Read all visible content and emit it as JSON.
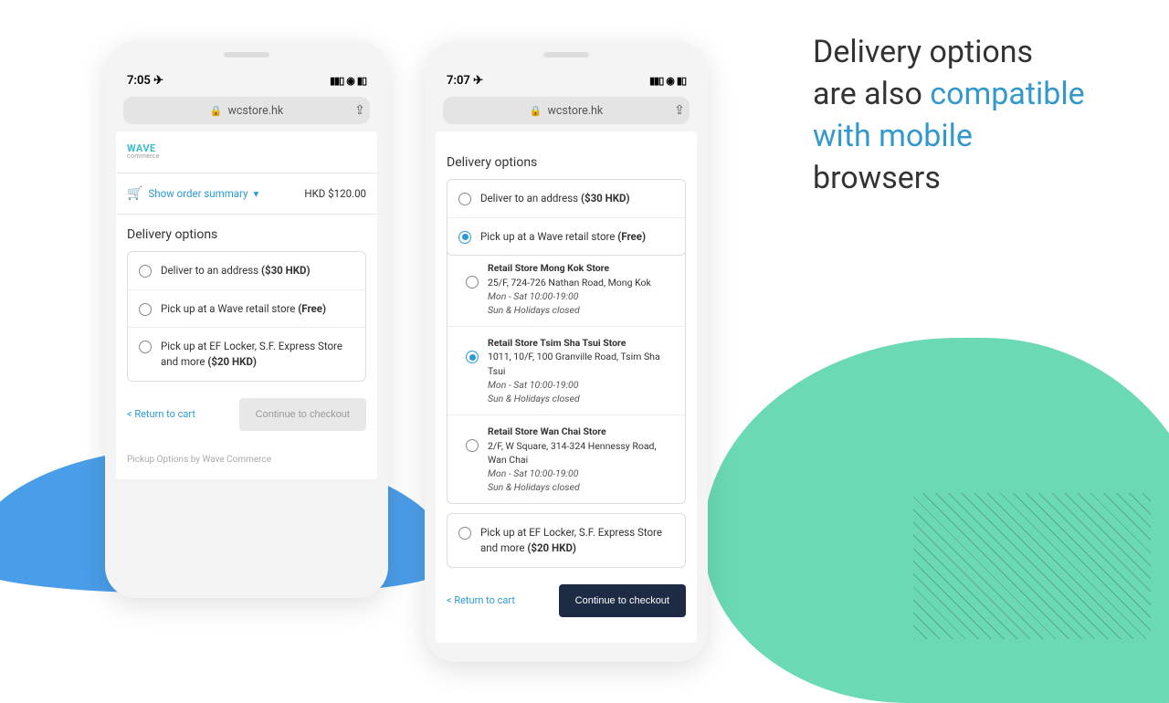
{
  "headline": {
    "line1": "Delivery options",
    "line2_plain": "are also ",
    "line2_accent": "compatible",
    "line3_accent": "with mobile",
    "line4_plain": "browsers"
  },
  "phoneLeft": {
    "time": "7:05",
    "url": "wcstore.hk",
    "brand_top": "WAVE",
    "brand_bottom": "commerce",
    "summary_toggle": "Show order summary",
    "summary_price": "HKD $120.00",
    "section_title": "Delivery options",
    "options": [
      {
        "label": "Deliver to an address ",
        "price": "($30 HKD)"
      },
      {
        "label": "Pick up at a Wave retail store ",
        "price": "(Free)"
      },
      {
        "label": "Pick up at EF Locker, S.F. Express Store and more ",
        "price": "($20 HKD)"
      }
    ],
    "return_link": "< Return to cart",
    "checkout_label": "Continue to checkout",
    "powered": "Pickup Options by Wave Commerce"
  },
  "phoneRight": {
    "time": "7:07",
    "url": "wcstore.hk",
    "section_title": "Delivery options",
    "option_deliver": {
      "label": "Deliver to an address ",
      "price": "($30 HKD)"
    },
    "option_pickup": {
      "label": "Pick up at a Wave retail store ",
      "price": "(Free)"
    },
    "stores": [
      {
        "name": "Retail Store Mong Kok Store",
        "address": "25/F, 724-726 Nathan Road, Mong Kok",
        "hours1": "Mon - Sat 10:00-19:00",
        "hours2": "Sun & Holidays closed"
      },
      {
        "name": "Retail Store Tsim Sha Tsui Store",
        "address": "1011, 10/F, 100 Granville Road, Tsim Sha Tsui",
        "hours1": "Mon - Sat 10:00-19:00",
        "hours2": "Sun & Holidays closed"
      },
      {
        "name": "Retail Store Wan Chai Store",
        "address": "2/F, W Square, 314-324 Hennessy Road, Wan Chai",
        "hours1": "Mon - Sat 10:00-19:00",
        "hours2": "Sun & Holidays closed"
      }
    ],
    "option_locker": {
      "label": "Pick up at EF Locker, S.F. Express Store and more ",
      "price": "($20 HKD)"
    },
    "return_link": "< Return to cart",
    "checkout_label": "Continue to checkout"
  }
}
